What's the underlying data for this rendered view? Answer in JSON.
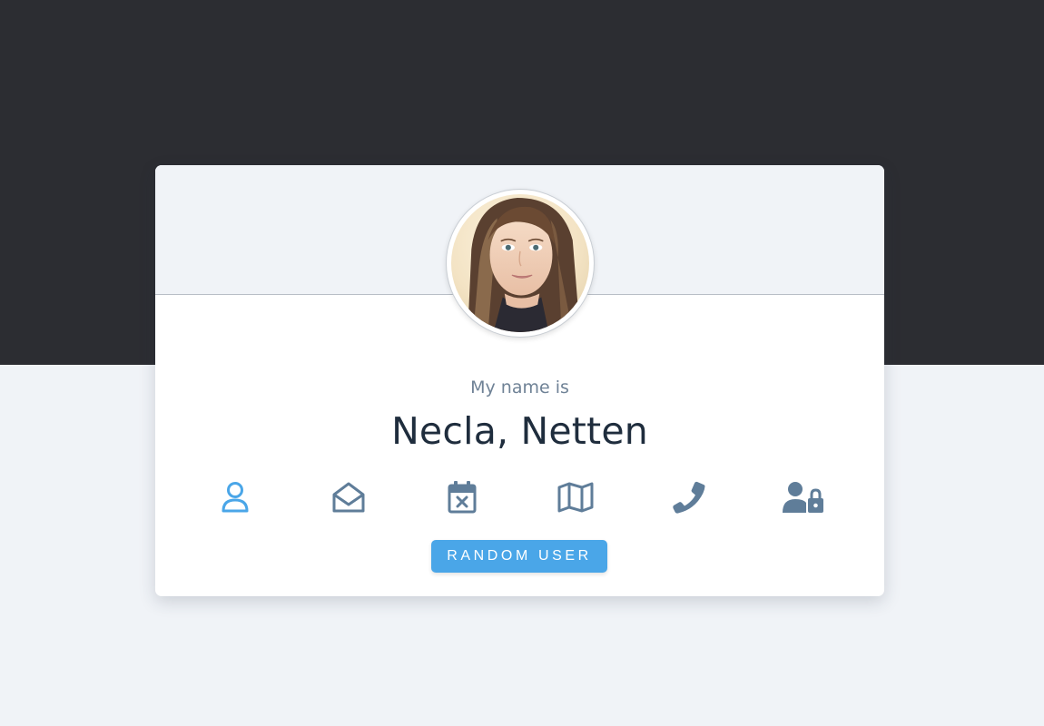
{
  "profile": {
    "intro": "My name is",
    "name": "Necla, Netten"
  },
  "actions": [
    {
      "icon": "user-icon",
      "active": true
    },
    {
      "icon": "envelope-open-icon",
      "active": false
    },
    {
      "icon": "calendar-x-icon",
      "active": false
    },
    {
      "icon": "map-icon",
      "active": false
    },
    {
      "icon": "phone-icon",
      "active": false
    },
    {
      "icon": "user-lock-icon",
      "active": false
    }
  ],
  "button": {
    "label": "Random User"
  },
  "colors": {
    "page_dark": "#2c2d32",
    "page_light": "#f0f3f7",
    "accent": "#4aa6e8",
    "icon_inactive": "#5f7d99",
    "name_text": "#1f2d3d"
  }
}
